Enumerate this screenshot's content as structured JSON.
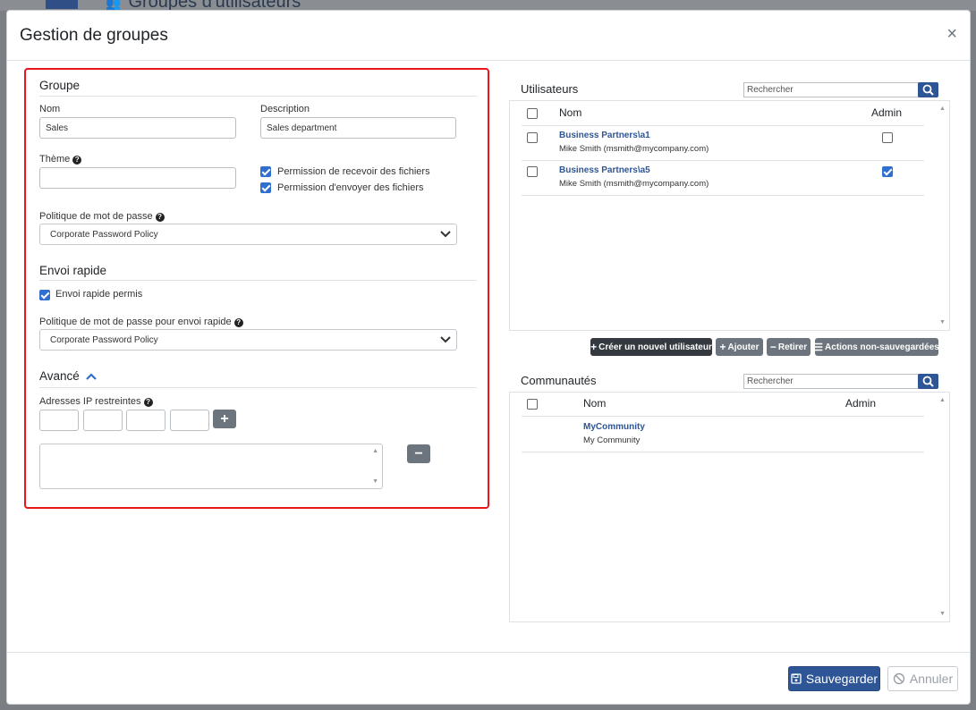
{
  "background": {
    "title": "Groupes d'utilisateurs"
  },
  "modal": {
    "title": "Gestion de groupes",
    "close_icon": "×"
  },
  "groupe": {
    "heading": "Groupe",
    "nom_label": "Nom",
    "nom_value": "Sales",
    "description_label": "Description",
    "description_value": "Sales department",
    "theme_label": "Thème",
    "theme_value": "",
    "perm_receive": {
      "label": "Permission de recevoir des fichiers",
      "checked": true
    },
    "perm_send": {
      "label": "Permission d'envoyer des fichiers",
      "checked": true
    },
    "password_policy_label": "Politique de mot de passe",
    "password_policy_value": "Corporate Password Policy"
  },
  "envoi_rapide": {
    "heading": "Envoi rapide",
    "permis": {
      "label": "Envoi rapide permis",
      "checked": true
    },
    "policy_label": "Politique de mot de passe pour envoi rapide",
    "policy_value": "Corporate Password Policy"
  },
  "avance": {
    "heading": "Avancé",
    "ip_label": "Adresses IP restreintes",
    "add_icon": "+",
    "remove_icon": "−"
  },
  "utilisateurs": {
    "title": "Utilisateurs",
    "search_placeholder": "Rechercher",
    "col_nom": "Nom",
    "col_admin": "Admin",
    "rows": [
      {
        "name": "Business Partners\\a1",
        "sub": "Mike Smith (msmith@mycompany.com)",
        "admin": false
      },
      {
        "name": "Business Partners\\a5",
        "sub": "Mike Smith (msmith@mycompany.com)",
        "admin": true
      }
    ],
    "actions": {
      "create": "Créer un nouvel utilisateur",
      "add": "Ajouter",
      "remove": "Retirer",
      "unsaved": "Actions non-sauvegardées"
    }
  },
  "communautes": {
    "title": "Communautés",
    "search_placeholder": "Rechercher",
    "col_nom": "Nom",
    "col_admin": "Admin",
    "rows": [
      {
        "name": "MyCommunity",
        "sub": "My Community"
      }
    ]
  },
  "footer": {
    "save": "Sauvegarder",
    "cancel": "Annuler"
  },
  "colors": {
    "primary": "#2e5596",
    "highlight_border": "#e8151b",
    "checkbox": "#2f6fcf"
  }
}
